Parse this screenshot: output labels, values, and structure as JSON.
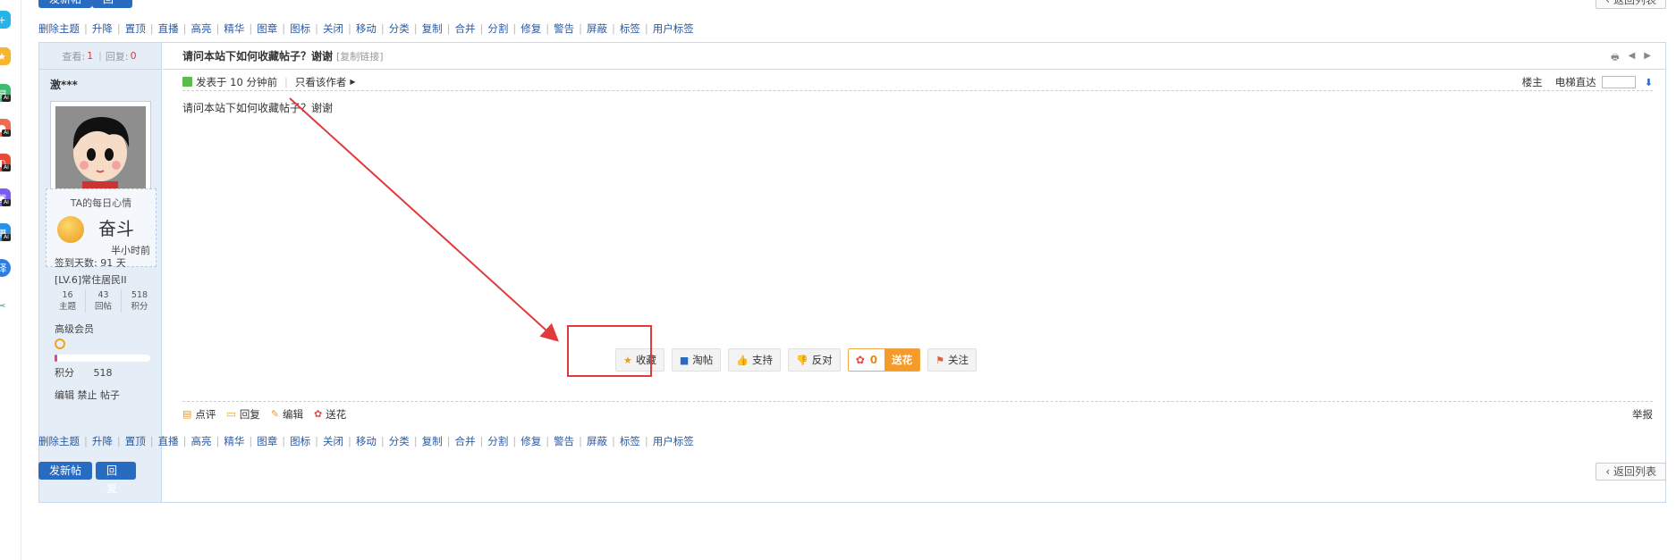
{
  "top_buttons": {
    "new_post": "发新帖",
    "reply": "回复",
    "back": "返回列表"
  },
  "mod_actions": [
    "删除主题",
    "升降",
    "置顶",
    "直播",
    "高亮",
    "精华",
    "图章",
    "图标",
    "关闭",
    "移动",
    "分类",
    "复制",
    "合并",
    "分割",
    "修复",
    "警告",
    "屏蔽",
    "标签",
    "用户标签"
  ],
  "stats": {
    "views_label": "查看:",
    "views": "1",
    "replies_label": "回复:",
    "replies": "0"
  },
  "author": {
    "name": "激***",
    "mood_title": "TA的每日心情",
    "mood_word": "奋斗",
    "mood_time": "半小时前",
    "checkin": "签到天数: 91 天",
    "level": "[LV.6]常住居民II",
    "counts": [
      {
        "value": "16",
        "label": "主题"
      },
      {
        "value": "43",
        "label": "回帖"
      },
      {
        "value": "518",
        "label": "积分"
      }
    ],
    "group": "高级会员",
    "progress": 0.03,
    "points_label": "积分",
    "points_value": "518",
    "admin_links": "编辑 禁止 帖子"
  },
  "thread": {
    "title": "请问本站下如何收藏帖子？谢谢",
    "copy_link": "[复制链接]",
    "posted": "发表于 10 分钟前",
    "only_author": "只看该作者",
    "floor_owner": "楼主",
    "elevator": "电梯直达",
    "body": "请问本站下如何收藏帖子？谢谢"
  },
  "actions": {
    "favorite": "收藏",
    "taotie": "淘帖",
    "support": "支持",
    "oppose": "反对",
    "flower_count": "0",
    "send_flower": "送花",
    "follow": "关注"
  },
  "footer": {
    "comment": "点评",
    "reply": "回复",
    "edit": "编辑",
    "flower": "送花",
    "report": "举报"
  },
  "colors": {
    "accent_blue": "#2a6bc2",
    "highlight_red": "#e13a3a",
    "flower_orange": "#f39c2c"
  }
}
